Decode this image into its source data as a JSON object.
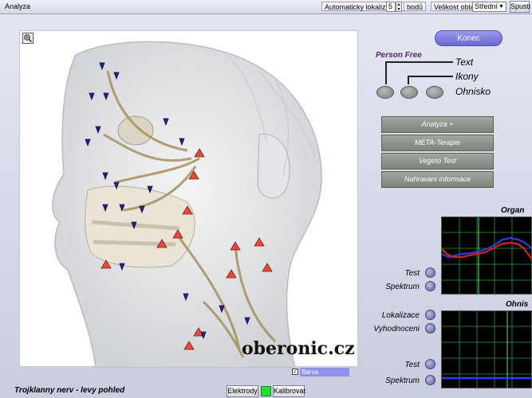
{
  "window": {
    "title": "Analyza"
  },
  "toolbar": {
    "auto_localize_label": "Automaticky lokalizovat:",
    "auto_localize_value": "5",
    "points_label": "bodů",
    "area_size_label": "Velikost oblasti:",
    "area_size_value": "Střední",
    "start_label": "Spusti"
  },
  "image": {
    "watermark": "oberonic.cz"
  },
  "buttons": {
    "konec": "Konec"
  },
  "person_free": {
    "title": "Person Free",
    "options": [
      "Text",
      "Ikony",
      "Ohnisko"
    ]
  },
  "menu": [
    "Analyza +",
    "META-Terapie",
    "Vegeto Test",
    "Nahravani informace"
  ],
  "organ_graph": {
    "title": "Organ",
    "labels": [
      "Test",
      "Spektrum"
    ]
  },
  "ohnis_graph": {
    "title": "Ohnis",
    "labels": [
      "Lokalizace",
      "Vyhodnoceni",
      "Test",
      "Spektrum"
    ]
  },
  "barva": {
    "label": "Barva",
    "checked": true
  },
  "caption": "Trojklanny nerv - levy pohled",
  "bottom": {
    "elektrody": "Elektrody",
    "kalibrovat": "Kalibrovat"
  },
  "colors": {
    "accent": "#7b79e0",
    "menu": "#8c9189",
    "marker_red": "#e8493a",
    "marker_blue": "#2a1f8f",
    "graph_green": "#1fa632"
  }
}
